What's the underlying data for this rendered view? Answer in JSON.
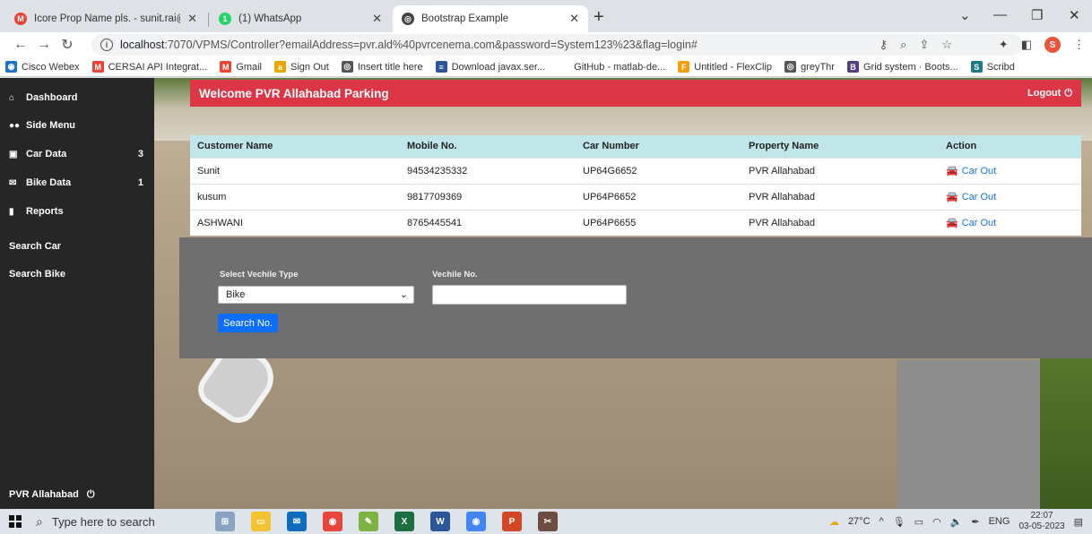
{
  "browser": {
    "tabs": [
      {
        "title": "Icore Prop Name pls. - sunit.rai@",
        "icon": "gmail-icon",
        "color": "#ea4335"
      },
      {
        "title": "(1) WhatsApp",
        "icon": "whatsapp-icon",
        "color": "#25d366"
      },
      {
        "title": "Bootstrap Example",
        "icon": "globe-icon",
        "color": "#444444"
      }
    ],
    "address": {
      "host": "localhost",
      "path": ":7070/VPMS/Controller?emailAddress=pvr.ald%40pvrcenema.com&password=System123%23&flag=login#"
    },
    "profile_initial": "S",
    "bookmarks": [
      {
        "label": "Cisco Webex",
        "icon": "webex-icon",
        "color": "#1d6fd1"
      },
      {
        "label": "CERSAI API Integrat...",
        "icon": "gmail-icon",
        "color": "#ea4335"
      },
      {
        "label": "Gmail",
        "icon": "gmail-icon",
        "color": "#ea4335"
      },
      {
        "label": "Sign Out",
        "icon": "signout-icon",
        "color": "#e6a700"
      },
      {
        "label": "Insert title here",
        "icon": "globe-icon",
        "color": "#555555"
      },
      {
        "label": "Download javax.ser...",
        "icon": "document-icon",
        "color": "#2b579a"
      },
      {
        "label": "GitHub - matlab-de...",
        "icon": "github-icon",
        "color": "#ffffff"
      },
      {
        "label": "Untitled - FlexClip",
        "icon": "flexclip-icon",
        "color": "#f59e0b"
      },
      {
        "label": "greyThr",
        "icon": "globe-icon",
        "color": "#555555"
      },
      {
        "label": "Grid system · Boots...",
        "icon": "bootstrap-icon",
        "color": "#563d7c"
      },
      {
        "label": "Scribd",
        "icon": "scribd-icon",
        "color": "#1e7b85"
      }
    ]
  },
  "sidebar": {
    "items": [
      {
        "label": "Dashboard",
        "icon": "home-icon",
        "glyph": "⌂",
        "count": ""
      },
      {
        "label": "Side Menu",
        "icon": "users-icon",
        "glyph": "👥",
        "count": ""
      },
      {
        "label": "Car Data",
        "icon": "calendar-icon",
        "glyph": "▣",
        "count": "3"
      },
      {
        "label": "Bike Data",
        "icon": "mail-icon",
        "glyph": "✉",
        "count": "1"
      },
      {
        "label": "Reports",
        "icon": "bar-chart-icon",
        "glyph": "▮",
        "count": ""
      },
      {
        "label": "Search Car",
        "icon": "",
        "glyph": "",
        "count": ""
      },
      {
        "label": "Search Bike",
        "icon": "",
        "glyph": "",
        "count": ""
      }
    ],
    "footer": "PVR Allahabad"
  },
  "header": {
    "title": "Welcome PVR Allahabad Parking",
    "logout_label": "Logout"
  },
  "table": {
    "columns": [
      "Customer Name",
      "Mobile No.",
      "Car Number",
      "Property Name",
      "Action"
    ],
    "rows": [
      {
        "name": "Sunit",
        "mobile": "94534235332",
        "car": "UP64G6652",
        "property": "PVR Allahabad",
        "action": "Car Out"
      },
      {
        "name": "kusum",
        "mobile": "9817709369",
        "car": "UP64P6652",
        "property": "PVR Allahabad",
        "action": "Car Out"
      },
      {
        "name": "ASHWANI",
        "mobile": "8765445541",
        "car": "UP64P6655",
        "property": "PVR Allahabad",
        "action": "Car Out"
      }
    ]
  },
  "search": {
    "type_label": "Select Vechile Type",
    "type_value": "Bike",
    "number_label": "Vechile No.",
    "number_value": "",
    "button_label": "Search No."
  },
  "taskbar": {
    "search_placeholder": "Type here to search",
    "weather": "27°C",
    "language": "ENG",
    "time": "22:07",
    "date": "03-05-2023"
  },
  "colors": {
    "welcome_bar": "#dc3545",
    "table_header": "#c0e6ea",
    "sidebar": "#262626",
    "search_button": "#0d6efd",
    "link": "#1a73e8"
  }
}
